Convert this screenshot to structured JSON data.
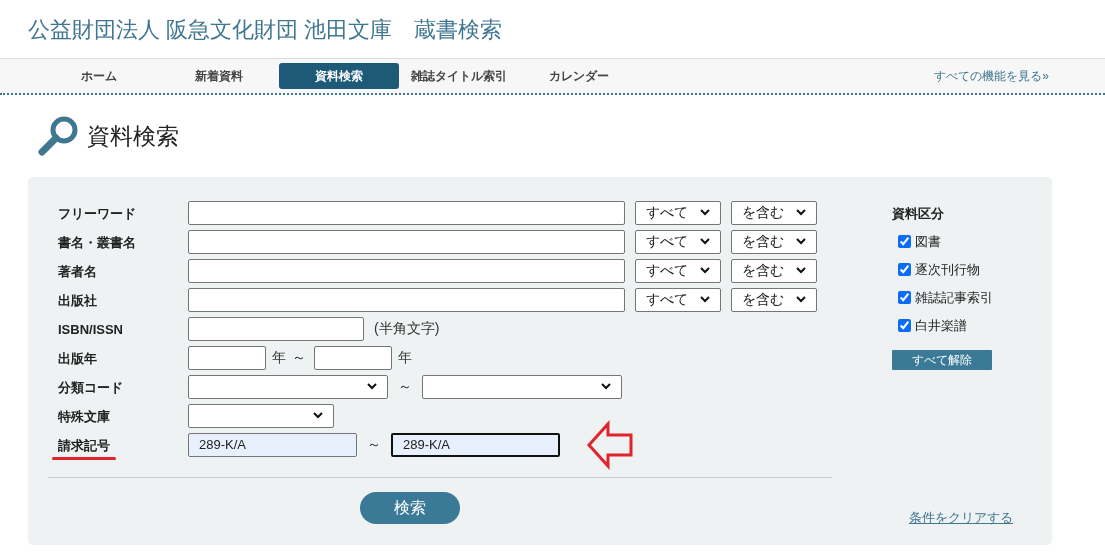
{
  "header": {
    "title": "公益財団法人 阪急文化財団 池田文庫　蔵書検索"
  },
  "nav": {
    "items": [
      {
        "label": "ホーム",
        "selected": false
      },
      {
        "label": "新着資料",
        "selected": false
      },
      {
        "label": "資料検索",
        "selected": true
      },
      {
        "label": "雑誌タイトル索引",
        "selected": false
      },
      {
        "label": "カレンダー",
        "selected": false
      }
    ],
    "all_link": "すべての機能を見る»"
  },
  "page_title": "資料検索",
  "form": {
    "rows": [
      {
        "kind": "keyword",
        "label": "フリーワード",
        "scope": "すべて",
        "mode": "を含む"
      },
      {
        "kind": "keyword",
        "label": "書名・叢書名",
        "scope": "すべて",
        "mode": "を含む"
      },
      {
        "kind": "keyword",
        "label": "著者名",
        "scope": "すべて",
        "mode": "を含む"
      },
      {
        "kind": "keyword",
        "label": "出版社",
        "scope": "すべて",
        "mode": "を含む"
      },
      {
        "kind": "note",
        "label": "ISBN/ISSN",
        "note": "(半角文字)"
      },
      {
        "kind": "year_range",
        "label": "出版年",
        "from_unit": "年",
        "separator": "～",
        "to_unit": "年"
      },
      {
        "kind": "select_range",
        "label": "分類コード",
        "separator": "～"
      },
      {
        "kind": "select",
        "label": "特殊文庫"
      },
      {
        "kind": "text_range",
        "label": "請求記号",
        "from_value": "289-K/A",
        "separator": "～",
        "to_value": "289-K/A",
        "marked": true
      }
    ],
    "search_button": "検索",
    "clear_link": "条件をクリアする"
  },
  "category": {
    "title": "資料区分",
    "items": [
      {
        "label": "図書",
        "checked": true
      },
      {
        "label": "逐次刊行物",
        "checked": true
      },
      {
        "label": "雑誌記事索引",
        "checked": true
      },
      {
        "label": "白井楽譜",
        "checked": true
      }
    ],
    "clear_button": "すべて解除"
  }
}
